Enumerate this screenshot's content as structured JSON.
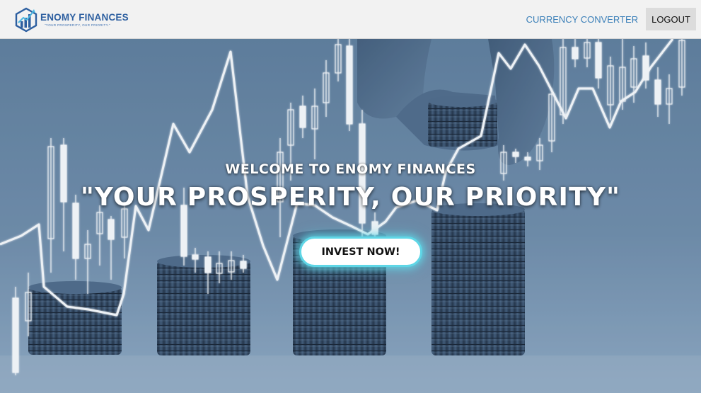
{
  "header": {
    "brand_name": "ENOMY FINANCES",
    "brand_tagline": "\"YOUR PROSPERITY, OUR PRIORITY.\"",
    "nav_currency_converter": "CURRENCY CONVERTER",
    "nav_logout": "LOGOUT"
  },
  "hero": {
    "welcome": "WELCOME TO ENOMY FINANCES",
    "tagline": "\"YOUR PROSPERITY, OUR PRIORITY\"",
    "cta_label": "INVEST NOW!",
    "background_image": "rising coin stacks with candlestick chart overlay"
  },
  "colors": {
    "brand_blue": "#2d5fa0",
    "nav_link": "#3a7fb8",
    "hero_tint": "#5f7f9f",
    "cta_glow": "#5fd6e6"
  },
  "icons": {
    "logo": "shield-bar-chart-icon"
  }
}
